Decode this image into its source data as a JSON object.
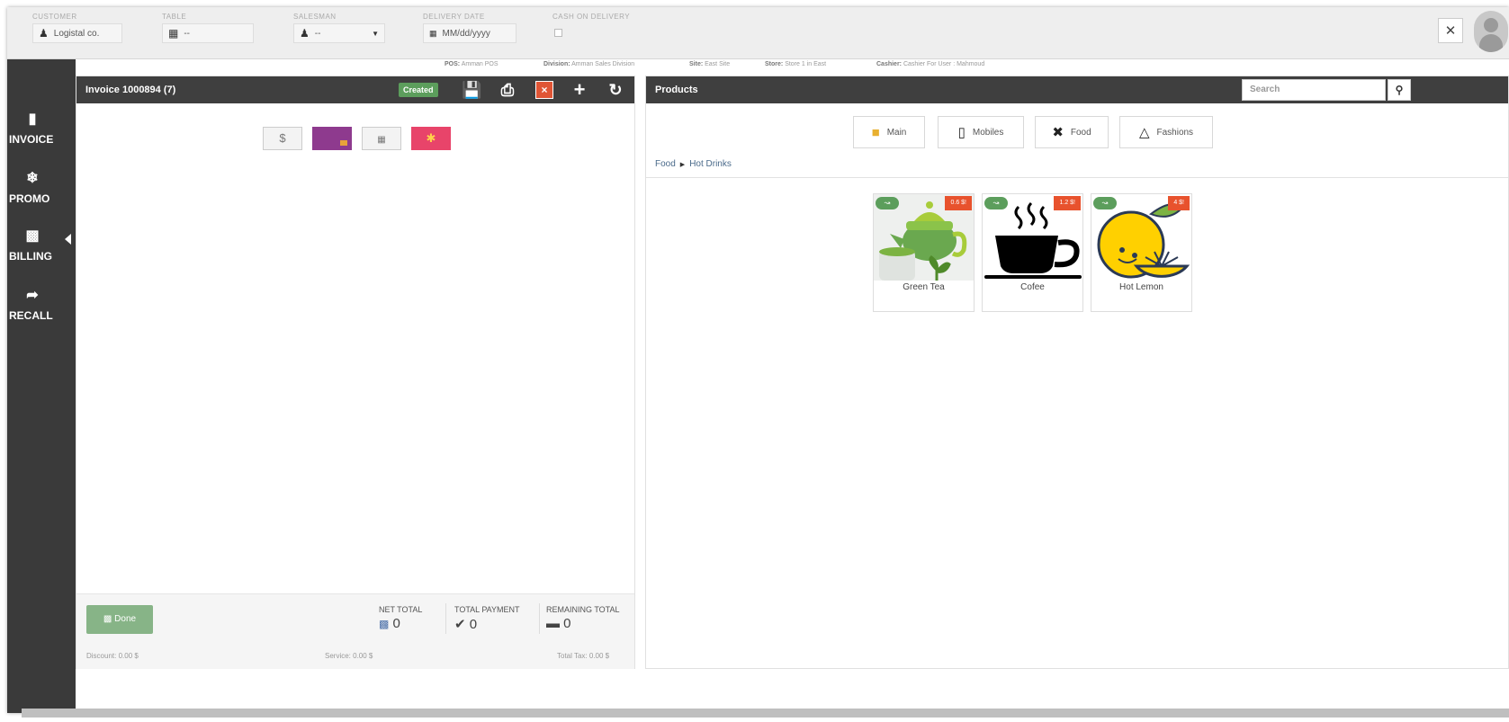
{
  "topbar": {
    "customer": {
      "label": "CUSTOMER",
      "value": "Logistal co."
    },
    "table": {
      "label": "TABLE",
      "value": "--"
    },
    "salesman": {
      "label": "SALESMAN",
      "value": "--"
    },
    "delivery_date": {
      "label": "DELIVERY DATE",
      "placeholder": "MM/dd/yyyy"
    },
    "cash_on_delivery": {
      "label": "CASH ON DELIVERY"
    }
  },
  "infobar": {
    "pos_label": "POS:",
    "pos_value": "Amman POS",
    "division_label": "Division:",
    "division_value": "Amman Sales Division",
    "site_label": "Site:",
    "site_value": "East Site",
    "store_label": "Store:",
    "store_value": "Store 1 in East",
    "cashier_label": "Cashier:",
    "cashier_value": "Cashier For User : Mahmoud"
  },
  "sidebar": {
    "items": [
      {
        "label": "INVOICE",
        "icon": "file-icon"
      },
      {
        "label": "PROMO",
        "icon": "snowflake-icon"
      },
      {
        "label": "BILLING",
        "icon": "money-icon"
      },
      {
        "label": "RECALL",
        "icon": "share-icon"
      }
    ]
  },
  "invoice": {
    "title": "Invoice 1000894 (7)",
    "status": "Created",
    "payment_methods": [
      "cash-icon",
      "credit-card-icon",
      "voucher-icon",
      "gift-card-icon"
    ],
    "cash_symbol": "$",
    "done_label": "Done",
    "net_total_label": "NET TOTAL",
    "net_total_value": "0",
    "total_payment_label": "TOTAL PAYMENT",
    "total_payment_value": "0",
    "remaining_total_label": "REMAINING TOTAL",
    "remaining_total_value": "0",
    "discount": "Discount: 0.00 $",
    "service": "Service: 0.00 $",
    "total_tax": "Total Tax: 0.00 $"
  },
  "products": {
    "title": "Products",
    "search_placeholder": "Search",
    "categories": [
      {
        "label": "Main",
        "icon": "box-icon"
      },
      {
        "label": "Mobiles",
        "icon": "mobile-icon"
      },
      {
        "label": "Food",
        "icon": "cutlery-icon"
      },
      {
        "label": "Fashions",
        "icon": "hanger-icon"
      }
    ],
    "breadcrumb": [
      "Food",
      "Hot Drinks"
    ],
    "items": [
      {
        "name": "Green Tea",
        "price": "0.6 $!"
      },
      {
        "name": "Cofee",
        "price": "1.2 $!"
      },
      {
        "name": "Hot Lemon",
        "price": "4 $!"
      }
    ]
  },
  "colors": {
    "sidebar": "#3a3a3a",
    "header": "#3f3f3f",
    "badge_green": "#5c9e5c",
    "price_orange": "#e8522d",
    "done_button": "#87b487"
  }
}
